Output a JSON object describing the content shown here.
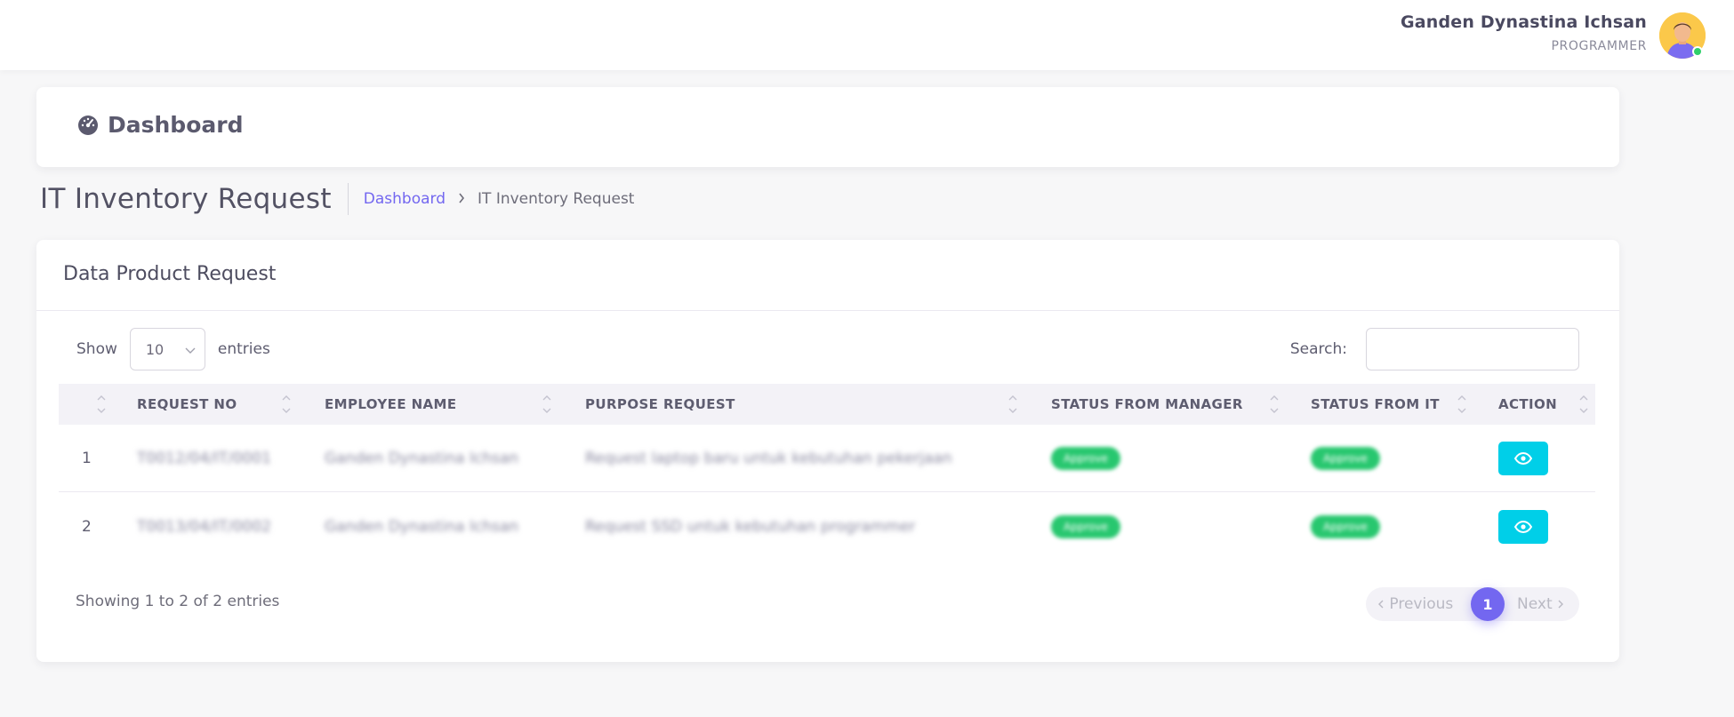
{
  "user": {
    "name": "Ganden Dynastina Ichsan",
    "role": "PROGRAMMER"
  },
  "dashboard_card": {
    "title": "Dashboard",
    "icon": "dashboard-gauge-icon"
  },
  "page": {
    "title": "IT Inventory Request",
    "breadcrumb": {
      "home": "Dashboard",
      "current": "IT Inventory Request"
    }
  },
  "table_card": {
    "title": "Data Product Request",
    "show_label": "Show",
    "entries_label": "entries",
    "page_size": "10",
    "search_label": "Search:",
    "search_value": "",
    "columns": [
      "",
      "REQUEST NO",
      "EMPLOYEE NAME",
      "PURPOSE REQUEST",
      "STATUS FROM MANAGER",
      "STATUS FROM IT",
      "ACTION"
    ],
    "rows": [
      {
        "index": "1",
        "request_no": "T0012/04/IT/0001",
        "employee_name": "Ganden Dynastina Ichsan",
        "purpose": "Request laptop baru untuk kebutuhan pekerjaan",
        "status_manager": "Approve",
        "status_it": "Approve"
      },
      {
        "index": "2",
        "request_no": "T0013/04/IT/0002",
        "employee_name": "Ganden Dynastina Ichsan",
        "purpose": "Request SSD untuk kebutuhan programmer",
        "status_manager": "Approve",
        "status_it": "Approve"
      }
    ],
    "info": "Showing 1 to 2 of 2 entries",
    "pagination": {
      "previous": "Previous",
      "current": "1",
      "next": "Next"
    }
  },
  "colors": {
    "accent": "#7367f0",
    "success": "#28c76f",
    "info": "#00cfe8"
  }
}
